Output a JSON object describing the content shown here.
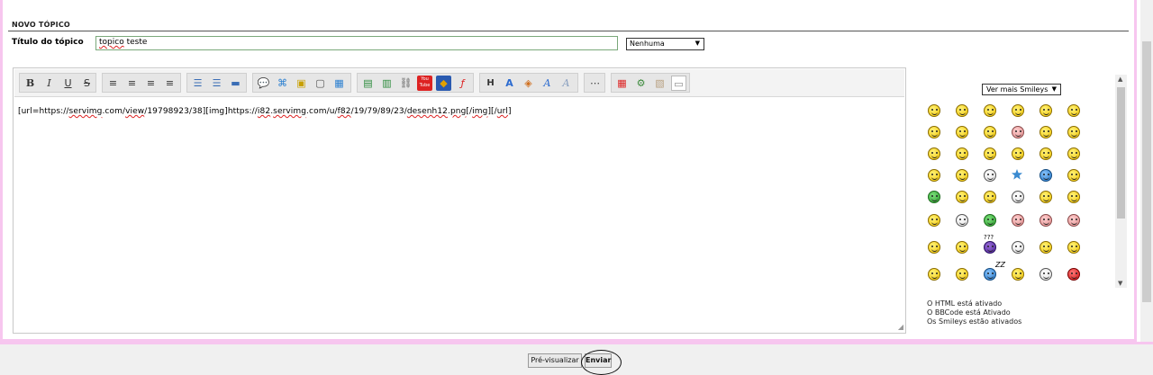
{
  "section": {
    "title": "NOVO TÓPICO"
  },
  "subject": {
    "label": "Título do tópico",
    "value_word1": "topico",
    "value_rest": " teste"
  },
  "icon_select": {
    "value": "Nenhuma",
    "arrow": "▼"
  },
  "editor": {
    "content_parts": [
      "[url=https://",
      "servimg",
      ".com/",
      "view",
      "/19798923/38][img]https://",
      "i82",
      ".",
      "servimg",
      ".com/u/",
      "f82",
      "/19/79/89/23/",
      "desenh12",
      ".",
      "png",
      "[/",
      "img",
      "][/",
      "url",
      "]"
    ],
    "grip": "◢"
  },
  "toolbar": {
    "bold": "B",
    "italic": "I",
    "underline": "U",
    "strike": "S",
    "align_left": "≡",
    "align_center": "≡",
    "align_right": "≡",
    "justify": "≡",
    "list_bullet": "☰",
    "list_number": "☰",
    "hr": "▬",
    "quote": "💬",
    "code": "⌘",
    "spoiler": "▣",
    "hide": "▢",
    "table": "▦",
    "image": "▤",
    "image_upload": "▥",
    "link": "⛓",
    "youtube": "You\nTube",
    "flash": "◆",
    "flash2": "ƒ",
    "heading": "H",
    "font_size": "A",
    "color": "◈",
    "font": "A",
    "clean": "A",
    "more": "⋯",
    "date": "▦",
    "calc": "⚙",
    "paste": "▧",
    "source": "▭"
  },
  "smileys": {
    "select_label": "Ver mais Smileys",
    "arrow": "▼",
    "rows": [
      [
        "yellow",
        "yellow",
        "yellow",
        "yellow",
        "yellow",
        "yellow"
      ],
      [
        "yellow",
        "yellow",
        "yellow",
        "pink",
        "yellow",
        "yellow"
      ],
      [
        "yellow",
        "yellow",
        "yellow",
        "yellow",
        "yellow",
        "yellow"
      ],
      [
        "yellow",
        "yellow",
        "white",
        "star",
        "blue",
        "yellow"
      ],
      [
        "green",
        "yellow",
        "yellow",
        "white",
        "yellow",
        "yellow"
      ],
      [
        "yellow",
        "white",
        "green",
        "pink",
        "pink",
        "pink"
      ],
      [
        "yellow",
        "yellow",
        "purple",
        "white",
        "yellow",
        "yellow"
      ],
      [
        "yellow",
        "yellow",
        "blue",
        "yellow",
        "white",
        "red"
      ]
    ],
    "zzz": "ZZ",
    "qmarks": "???"
  },
  "status": {
    "html": "O HTML está ativado",
    "bbcode": "O BBCode está Ativado",
    "smileys": "Os Smileys estão ativados"
  },
  "buttons": {
    "preview": "Pré-visualizar",
    "send": "Enviar"
  },
  "scroll_arrows": {
    "up": "▲",
    "down": "▼"
  }
}
